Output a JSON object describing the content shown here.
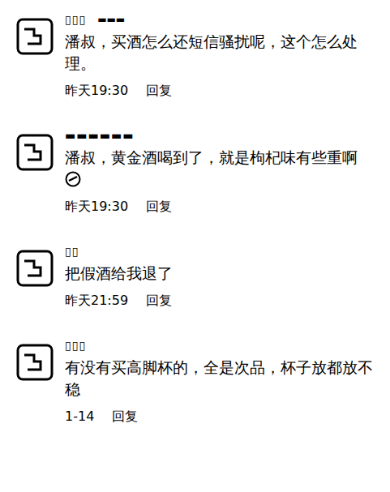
{
  "comments": [
    {
      "name": "▯▯▯",
      "tag": "▬▬▬",
      "text": "潘叔，买酒怎么还短信骚扰呢，这个怎么处理。",
      "time": "昨天19:30",
      "reply": "回复",
      "emoji": false
    },
    {
      "name": "▬▬▬▬▬▬",
      "tag": "",
      "text": "潘叔，黄金酒喝到了，就是枸杞味有些重啊",
      "time": "昨天19:30",
      "reply": "回复",
      "emoji": true
    },
    {
      "name": "▯▯",
      "tag": "",
      "text": "把假酒给我退了",
      "time": "昨天21:59",
      "reply": "回复",
      "emoji": false
    },
    {
      "name": "▯▯▯",
      "tag": "",
      "text": "有没有买高脚杯的，全是次品，杯子放都放不稳",
      "time": "1-14",
      "reply": "回复",
      "emoji": false
    }
  ]
}
